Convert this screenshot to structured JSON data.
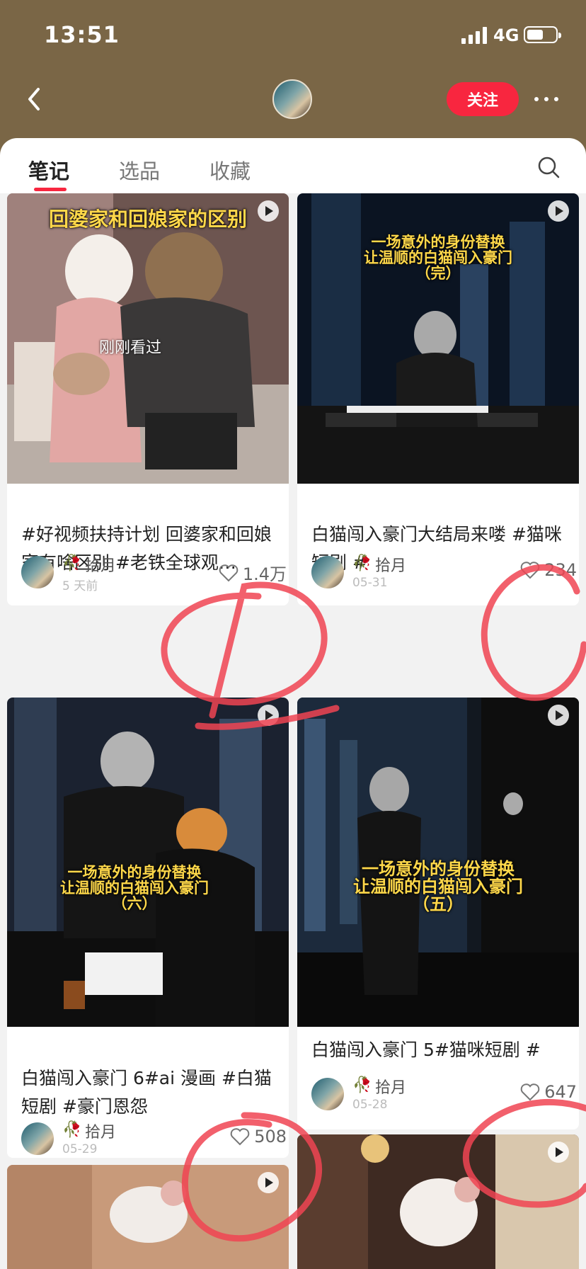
{
  "status_bar": {
    "time": "13:51",
    "network": "4G"
  },
  "header": {
    "follow_label": "关注"
  },
  "tabs": [
    {
      "label": "笔记",
      "active": true
    },
    {
      "label": "选品",
      "active": false
    },
    {
      "label": "收藏",
      "active": false
    }
  ],
  "cards": [
    {
      "overlay": "回婆家和回娘家的区别",
      "badge": "刚刚看过",
      "title": "#好视频扶持计划 回婆家和回娘家有啥区别 #老铁全球观…",
      "author": "拾月",
      "date": "5 天前",
      "likes": "1.4万"
    },
    {
      "overlay_lines": [
        "一场意外的身份替换",
        "让温顺的白猫闯入豪门",
        "（完）"
      ],
      "title": "白猫闯入豪门大结局来喽 #猫咪短剧 #",
      "author": "拾月",
      "date": "05-31",
      "likes": "234"
    },
    {
      "overlay_lines": [
        "一场意外的身份替换",
        "让温顺的白猫闯入豪门",
        "（六）"
      ],
      "title": "白猫闯入豪门 6#ai 漫画 #白猫短剧 #豪门恩怨",
      "author": "拾月",
      "date": "05-29",
      "likes": "508"
    },
    {
      "overlay_lines": [
        "一场意外的身份替换",
        "让温顺的白猫闯入豪门",
        "（五）"
      ],
      "title": "白猫闯入豪门 5#猫咪短剧 #",
      "author": "拾月",
      "date": "05-28",
      "likes": "647"
    }
  ],
  "colors": {
    "accent": "#f8263f",
    "header_bg": "#7a6646",
    "overlay_text": "#ffd84a"
  }
}
